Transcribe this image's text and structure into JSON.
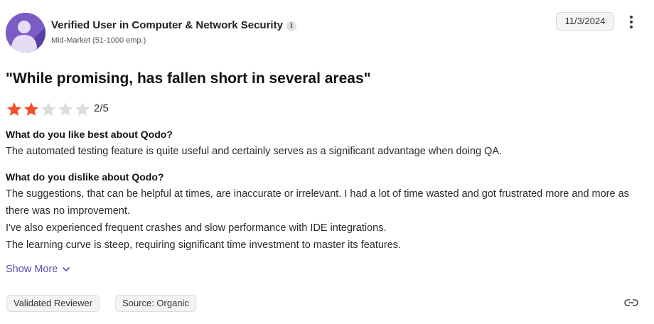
{
  "reviewer": {
    "name": "Verified User in Computer & Network Security",
    "info_icon": "info-icon",
    "segment": "Mid-Market (51-1000 emp.)",
    "avatar_color": "#7b5cc4"
  },
  "date": "11/3/2024",
  "review": {
    "title": "\"While promising, has fallen short in several areas\"",
    "rating": 2,
    "max_rating": 5,
    "rating_label": "2/5",
    "star_filled_color": "#f0502a",
    "star_empty_color": "#dcdcdc",
    "q1": "What do you like best about Qodo?",
    "a1": "The automated testing feature is quite useful and certainly serves as a significant advantage when doing QA.",
    "q2": "What do you dislike about Qodo?",
    "a2_lines": [
      "The suggestions, that can be helpful at times, are inaccurate or irrelevant. I had a lot of time wasted and got frustrated more and more as there was no improvement.",
      "I've also experienced frequent crashes and slow performance with IDE integrations.",
      "The learning curve is steep, requiring significant time investment to master its features."
    ]
  },
  "show_more_label": "Show More",
  "tags": [
    "Validated Reviewer",
    "Source: Organic"
  ],
  "accent_color": "#5a4db0"
}
